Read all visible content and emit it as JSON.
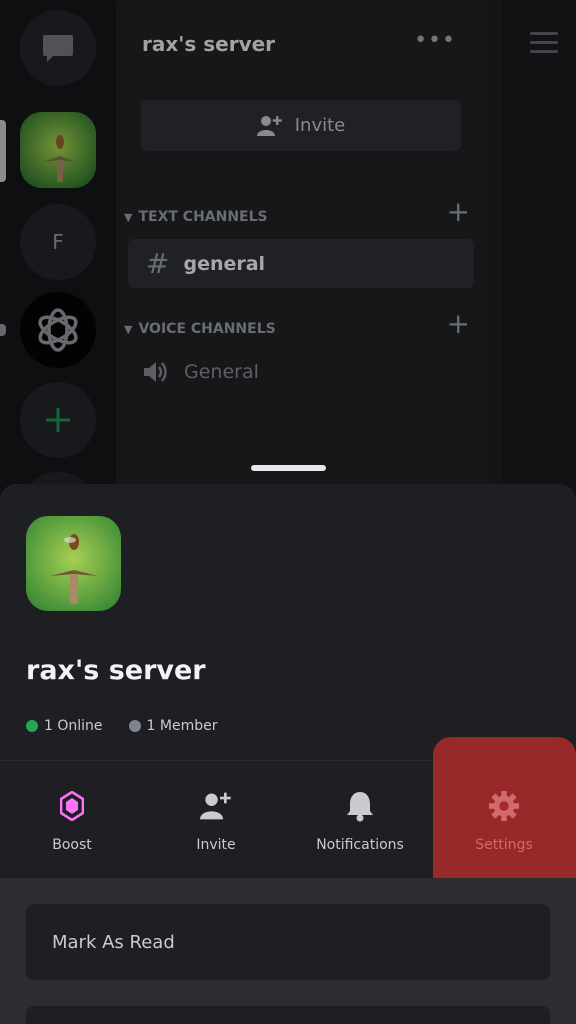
{
  "background": {
    "server_title": "rax's server",
    "invite_label": "Invite",
    "categories": {
      "text": "TEXT CHANNELS",
      "voice": "VOICE CHANNELS"
    },
    "channels": {
      "text_channel": "general",
      "voice_channel": "General"
    },
    "rail": {
      "f_letter": "F"
    }
  },
  "sheet": {
    "server_name": "rax's server",
    "online": "1 Online",
    "members": "1 Member",
    "actions": [
      {
        "label": "Boost",
        "icon": "boost-icon"
      },
      {
        "label": "Invite",
        "icon": "add-user-icon"
      },
      {
        "label": "Notifications",
        "icon": "bell-icon"
      },
      {
        "label": "Settings",
        "icon": "gear-icon"
      }
    ],
    "menu": {
      "mark_as_read": "Mark As Read"
    }
  },
  "colors": {
    "online": "#23a559",
    "boost": "#ff73fa",
    "settings_highlight": "#a32a2d"
  }
}
